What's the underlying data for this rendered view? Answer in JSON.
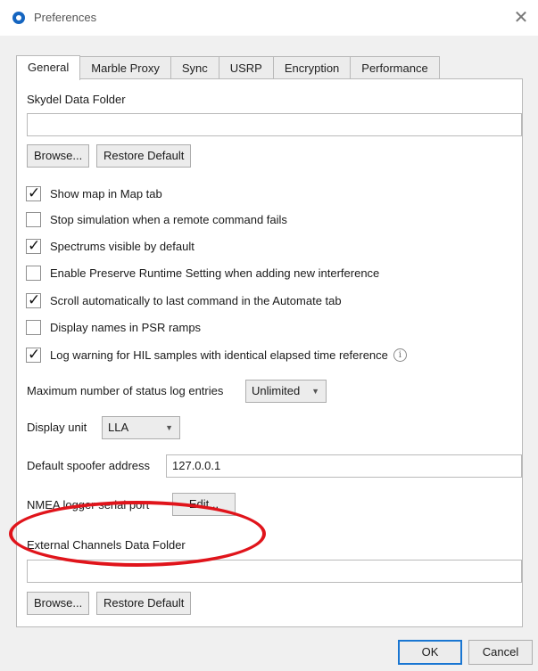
{
  "window": {
    "title": "Preferences",
    "close_glyph": "✕"
  },
  "tabs": [
    {
      "label": "General",
      "active": true
    },
    {
      "label": "Marble Proxy",
      "active": false
    },
    {
      "label": "Sync",
      "active": false
    },
    {
      "label": "USRP",
      "active": false
    },
    {
      "label": "Encryption",
      "active": false
    },
    {
      "label": "Performance",
      "active": false
    }
  ],
  "general": {
    "data_folder": {
      "label": "Skydel Data Folder",
      "value": "",
      "browse_label": "Browse...",
      "restore_label": "Restore Default"
    },
    "options": [
      {
        "label": "Show map in Map tab",
        "checked": true
      },
      {
        "label": "Stop simulation when a remote command fails",
        "checked": false
      },
      {
        "label": "Spectrums visible by default",
        "checked": true
      },
      {
        "label": "Enable Preserve Runtime Setting when adding new interference",
        "checked": false
      },
      {
        "label": "Scroll automatically to last command in the Automate tab",
        "checked": true
      },
      {
        "label": "Display names in PSR ramps",
        "checked": false
      },
      {
        "label": "Log warning for HIL samples with identical elapsed time reference",
        "checked": true
      }
    ],
    "info_glyph": "i",
    "max_status_log": {
      "label": "Maximum number of status log entries",
      "value": "Unlimited"
    },
    "display_unit": {
      "label": "Display unit",
      "value": "LLA"
    },
    "spoofer": {
      "label": "Default spoofer address",
      "value": "127.0.0.1"
    },
    "nmea": {
      "label": "NMEA logger serial port",
      "edit_label": "Edit..."
    },
    "external_channels": {
      "label": "External Channels Data Folder",
      "value": "",
      "browse_label": "Browse...",
      "restore_label": "Restore Default"
    }
  },
  "footer": {
    "ok_label": "OK",
    "cancel_label": "Cancel"
  },
  "colors": {
    "highlight_circle": "#e0141b",
    "app_icon": "#1565c0",
    "default_button_border": "#1976d2"
  }
}
